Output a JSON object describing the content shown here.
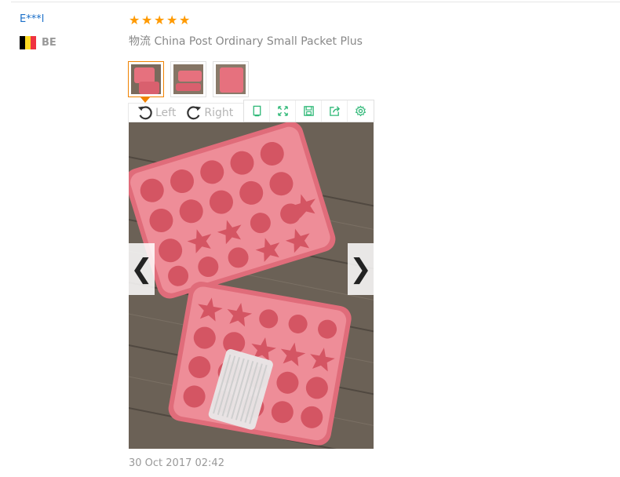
{
  "review": {
    "buyer_name": "E***l",
    "country_code": "BE",
    "flag_colors": [
      "#000000",
      "#fdda24",
      "#ef3340"
    ],
    "rating": 5,
    "star_glyph": "★",
    "shipping": "物流 China Post Ordinary Small Packet Plus",
    "date": "30 Oct 2017 02:42"
  },
  "viewer": {
    "rotate_left_label": "Left",
    "rotate_right_label": "Right",
    "prev_glyph": "❮",
    "next_glyph": "❯",
    "tool_icons": [
      "fit-icon",
      "fullscreen-icon",
      "save-icon",
      "share-icon",
      "settings-icon"
    ],
    "tool_color": "#2fb877",
    "thumbnail_count": 3,
    "active_thumbnail": 1
  }
}
